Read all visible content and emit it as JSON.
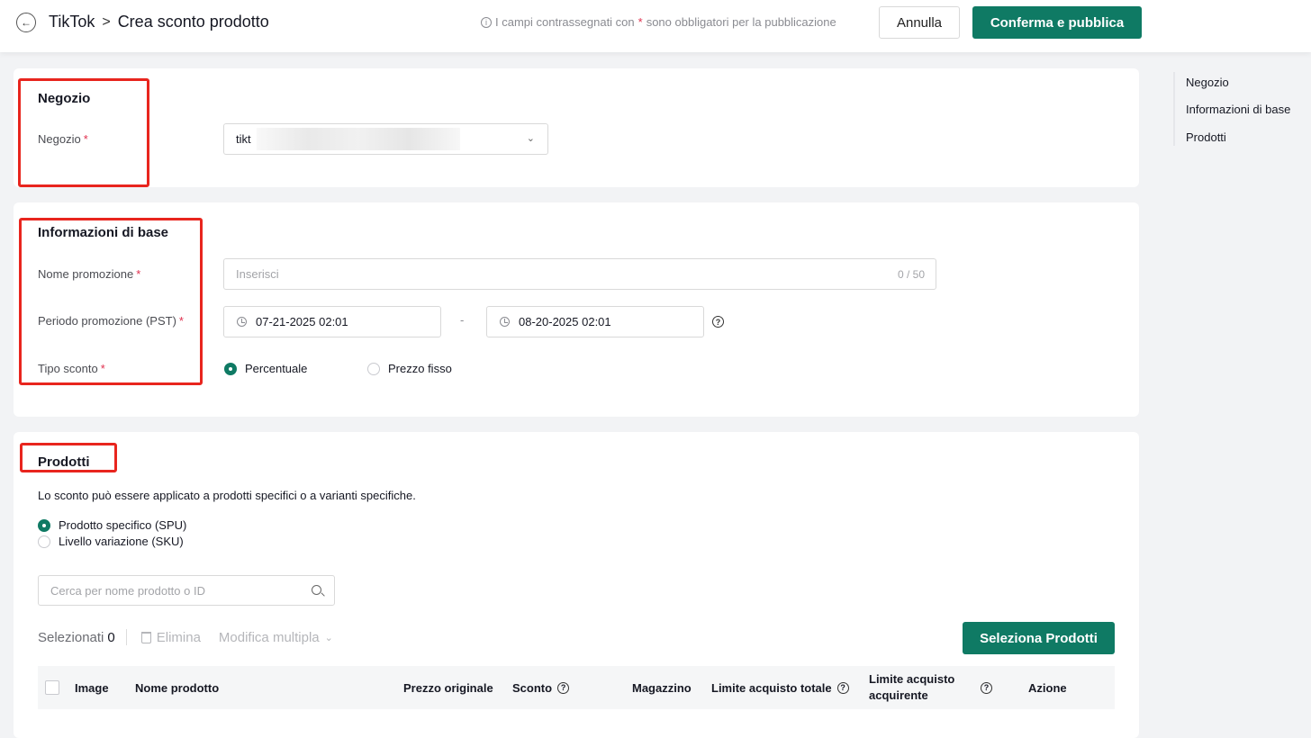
{
  "header": {
    "breadcrumb_root": "TikTok",
    "breadcrumb_sep": ">",
    "page_title": "Crea sconto prodotto",
    "hint_prefix": "I campi contrassegnati con",
    "hint_star": "*",
    "hint_suffix": "sono obbligatori per la pubblicazione",
    "cancel_label": "Annulla",
    "publish_label": "Conferma e pubblica"
  },
  "shop_section": {
    "title": "Negozio",
    "label": "Negozio",
    "required": "*",
    "selected_value": "tikt"
  },
  "basic_section": {
    "title": "Informazioni di base",
    "name_label": "Nome promozione",
    "name_placeholder": "Inserisci",
    "name_counter": "0 / 50",
    "period_label": "Periodo promozione (PST)",
    "start_date": "07-21-2025 02:01",
    "range_sep": "-",
    "end_date": "08-20-2025 02:01",
    "type_label": "Tipo sconto",
    "type_options": [
      "Percentuale",
      "Prezzo fisso"
    ],
    "type_selected": "Percentuale",
    "required": "*"
  },
  "products_section": {
    "title": "Prodotti",
    "description": "Lo sconto può essere applicato a prodotti specifici o a varianti specifiche.",
    "scope_options": [
      "Prodotto specifico (SPU)",
      "Livello variazione (SKU)"
    ],
    "scope_selected": "Prodotto specifico (SPU)",
    "search_placeholder": "Cerca per nome prodotto o ID",
    "selected_label": "Selezionati",
    "selected_count": "0",
    "delete_label": "Elimina",
    "bulk_edit_label": "Modifica multipla",
    "select_products_label": "Seleziona Prodotti",
    "columns": [
      "Image",
      "Nome prodotto",
      "Prezzo originale",
      "Sconto",
      "Magazzino",
      "Limite acquisto totale",
      "Limite acquisto acquirente",
      "Azione"
    ]
  },
  "anchor_nav": [
    "Negozio",
    "Informazioni di base",
    "Prodotti"
  ],
  "colors": {
    "accent": "#0f7a64",
    "required": "#e0304e",
    "annotation": "#e8251e"
  }
}
